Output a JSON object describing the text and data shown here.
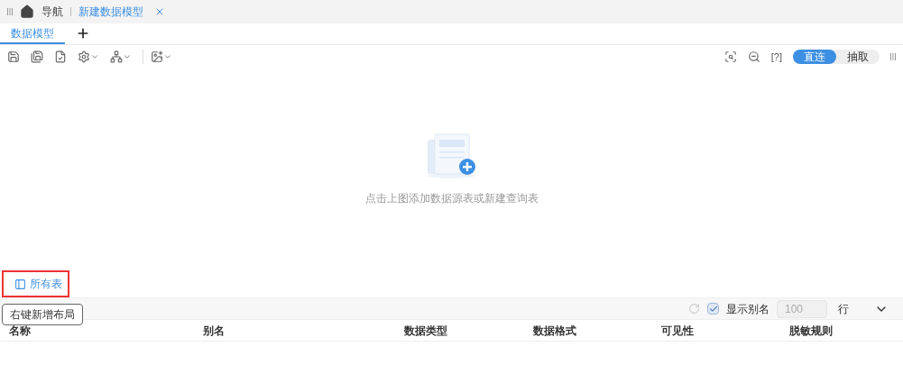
{
  "nav": {
    "home_label": "导航",
    "tabs": [
      {
        "label": "新建数据模型",
        "selected": true
      }
    ]
  },
  "model_tabs": [
    {
      "label": "数据模型",
      "selected": true
    }
  ],
  "mode_toggle": [
    {
      "label": "直连",
      "selected": true
    },
    {
      "label": "抽取",
      "selected": false
    }
  ],
  "help_label": "[?]",
  "empty_state": {
    "message": "点击上图添加数据源表或新建查询表"
  },
  "table_list_button": {
    "label": "所有表"
  },
  "tooltip": "右键新增布局",
  "fields_toolbar": {
    "show_alias": {
      "label": "显示别名",
      "checked": true
    },
    "row_count": {
      "value": "100"
    },
    "row_unit": "行"
  },
  "table": {
    "columns": [
      "名称",
      "别名",
      "数据类型",
      "数据格式",
      "可见性",
      "脱敏规则"
    ]
  }
}
